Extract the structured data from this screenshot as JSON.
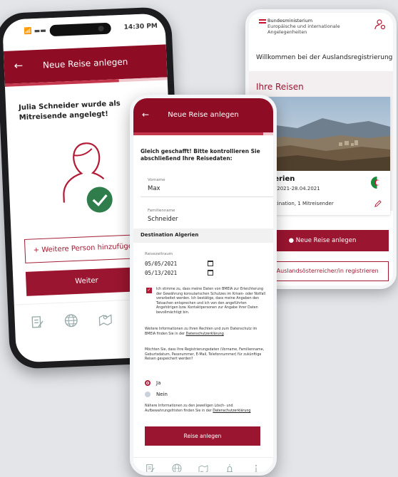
{
  "phone1": {
    "status": {
      "time": "14:30 PM",
      "signal": "📶 ▬▬"
    },
    "header": {
      "back": "←",
      "title": "Neue Reise anlegen"
    },
    "message": "Julia Schneider wurde als Mitreisende angelegt!",
    "add_person_label": "+ Weitere Person hinzufügen",
    "next_label": "Weiter",
    "nav_icons": [
      "form-icon",
      "globe-icon",
      "map-pin-icon",
      "alarm-icon"
    ]
  },
  "phone2": {
    "header": {
      "back": "←",
      "title": "Neue Reise anlegen"
    },
    "intro": "Gleich geschafft! Bitte kontrollieren Sie abschließend Ihre Reisedaten:",
    "fields": [
      {
        "label": "Vorname",
        "value": "Max"
      },
      {
        "label": "Familienname",
        "value": "Schneider"
      }
    ],
    "destination_heading": "Destination Algerien",
    "period_label": "Reisezeitraum",
    "date_from": "05/05/2021",
    "date_to": "05/13/2021",
    "consent_text": "Ich stimme zu, dass meine Daten von BMEIA zur Erleichterung der Gewährung konsularischen Schutzes im Krisen- oder Notfall verarbeitet werden. Ich bestätige, dass meine Angaben den Tatsachen entsprechen und ich von den angeführten Angehörigen bzw. Kontaktpersonen zur Angabe ihrer Daten bevollmächtigt bin.",
    "info_text": "Weitere Informationen zu Ihren Rechten und zum Datenschutz im BMEIA finden Sie in der",
    "info_link": "Datenschutzerklärung",
    "question": "Möchten Sie, dass Ihre Registrierungsdaten (Vorname, Familienname, Geburtsdatum, Passnummer, E-Mail, Telefonnummer) für zukünftige Reisen gespeichert werden?",
    "options": [
      {
        "label": "Ja",
        "selected": true
      },
      {
        "label": "Nein",
        "selected": false
      }
    ],
    "retention_text": "Nähere Informationen zu den jeweiligen Lösch- und Aufbewahrungsfristen finden Sie in der",
    "retention_link": "Datenschutzerklärung",
    "submit_label": "Reise anlegen",
    "nav_icons": [
      "form-icon",
      "globe-icon",
      "map-pin-icon",
      "alarm-icon",
      "info-icon"
    ]
  },
  "phone3": {
    "org_line1": "Bundesministerium",
    "org_line2": "Europäische und internationale",
    "org_line3": "Angelegenheiten",
    "welcome": "Willkommen bei der Auslandsregistrierung!",
    "trips_heading": "Ihre Reisen",
    "trip": {
      "destination": "Algerien",
      "dates": "20.04.2021-28.04.2021",
      "meta": "1 Destination, 1 Mitreisender"
    },
    "new_trip_label": "Neue Reise anlegen",
    "register_label": "Als Auslandsösterreicher/in registrieren"
  },
  "colors": {
    "brand": "#8e0d24",
    "button": "#9a1530",
    "check_green": "#2e7d4a"
  }
}
